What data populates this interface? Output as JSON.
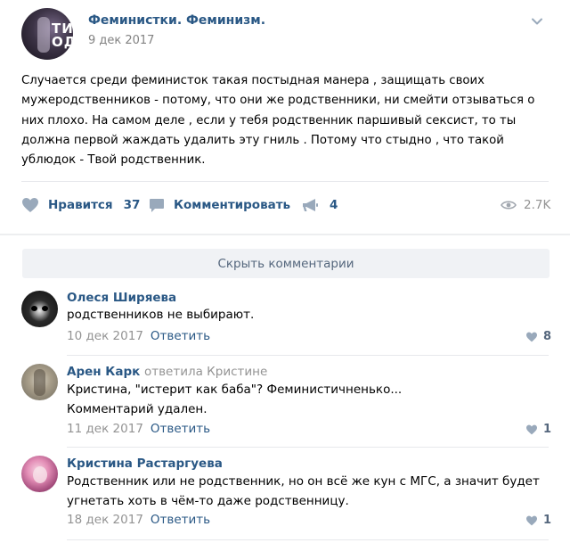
{
  "post": {
    "author": "Феминистки. Феминизм.",
    "date": "9 дек 2017",
    "avatar_text": "ТИ\nОДІ",
    "text": "Случается среди феминисток такая постыдная манера , защищать своих мужеродственников - потому, что они же родственники, ни смейти отзываться о них плохо. На самом деле , если у тебя родственник паршивый сексист, то ты должна первой жаждать удалить эту гниль . Потому что стыдно , что такой ублюдок - Твой родственник.",
    "actions": {
      "like_label": "Нравится",
      "like_count": "37",
      "comment_label": "Комментировать",
      "share_count": "4",
      "views": "2.7K"
    }
  },
  "comments_toggle": "Скрыть комментарии",
  "comments": [
    {
      "author": "Олеся Ширяева",
      "reply_to": "",
      "text": "родственников не выбирают.",
      "date": "10 дек 2017",
      "reply_label": "Ответить",
      "likes": "8"
    },
    {
      "author": "Арен Карк",
      "reply_to": "ответила Кристине",
      "text": "Кристина, \"истерит как баба\"? Феминистичненько...\nКомментарий удален.",
      "date": "11 дек 2017",
      "reply_label": "Ответить",
      "likes": "1"
    },
    {
      "author": "Кристина Растаргуева",
      "reply_to": "",
      "text": "Родственник или не родственник, но он всё же кун с МГС, а значит будет угнетать хоть в чём-то даже родственницу.",
      "date": "18 дек 2017",
      "reply_label": "Ответить",
      "likes": "1"
    }
  ],
  "colors": {
    "link": "#2a5885",
    "muted": "#939393",
    "icon": "#99a9bb",
    "divider": "#e7e8ec",
    "button_bg": "#f0f2f5"
  },
  "icons": {
    "menu": "chevron-down-icon",
    "like": "heart-icon",
    "comment": "speech-bubble-icon",
    "share": "megaphone-icon",
    "views": "eye-icon"
  }
}
